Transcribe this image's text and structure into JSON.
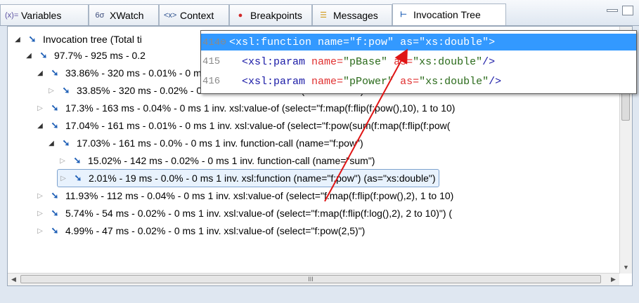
{
  "tabs": [
    {
      "icon": "(x)=",
      "label": "Variables"
    },
    {
      "icon": "6σ",
      "label": "XWatch"
    },
    {
      "icon": "<x>",
      "label": "Context"
    },
    {
      "icon": "●",
      "label": "Breakpoints"
    },
    {
      "icon": "☰",
      "label": "Messages"
    },
    {
      "icon": "⊢",
      "label": "Invocation Tree"
    }
  ],
  "tree": {
    "rows": [
      {
        "text": "Invocation tree (Total ti"
      },
      {
        "text": "97.7% - 925 ms - 0.2"
      },
      {
        "text": "33.86% - 320 ms - 0.01% - 0 ms 1 inv. xsl:value-of (select=\"sum(f:map(f:flip(f:pow(),10), 1 to"
      },
      {
        "text": "33.85% - 320 ms - 0.02% - 0 ms 1 inv. function-call (name=\"sum\")"
      },
      {
        "text": "17.3% - 163 ms - 0.04% - 0 ms 1 inv. xsl:value-of (select=\"f:map(f:flip(f:pow(),10), 1 to 10)"
      },
      {
        "text": "17.04% - 161 ms - 0.01% - 0 ms 1 inv. xsl:value-of (select=\"f:pow(sum(f:map(f:flip(f:pow("
      },
      {
        "text": "17.03% - 161 ms - 0.0% - 0 ms 1 inv. function-call (name=\"f:pow\")"
      },
      {
        "text": "15.02% - 142 ms - 0.02% - 0 ms 1 inv. function-call (name=\"sum\")"
      },
      {
        "text": "2.01% - 19 ms - 0.0% - 0 ms 1 inv. xsl:function (name=\"f:pow\") (as=\"xs:double\")"
      },
      {
        "text": "11.93% - 112 ms - 0.04% - 0 ms 1 inv. xsl:value-of (select=\"f:map(f:flip(f:pow(),2), 1 to 10)"
      },
      {
        "text": "5.74% - 54 ms - 0.02% - 0 ms 1 inv. xsl:value-of (select=\"f:map(f:flip(f:log(),2), 2 to 10)\") ("
      },
      {
        "text": "4.99% - 47 ms - 0.02% - 0 ms 1 inv. xsl:value-of (select=\"f:pow(2,5)\")"
      }
    ]
  },
  "popup": {
    "lines": [
      {
        "num": "414⊖",
        "tag": "<xsl:function",
        "a1": " name=",
        "v1": "\"f:pow\"",
        "a2": " as=",
        "v2": "\"xs:double\"",
        "end": ">"
      },
      {
        "num": "415",
        "tag": "  <xsl:param",
        "a1": " name=",
        "v1": "\"pBase\"",
        "a2": " as=",
        "v2": "\"xs:double\"",
        "end": "/>"
      },
      {
        "num": "416",
        "tag": "  <xsl:param",
        "a1": " name=",
        "v1": "\"pPower\"",
        "a2": " as=",
        "v2": "\"xs:double\"",
        "end": "/>"
      }
    ]
  },
  "scroll": {
    "h_thumb_grip": "III"
  }
}
